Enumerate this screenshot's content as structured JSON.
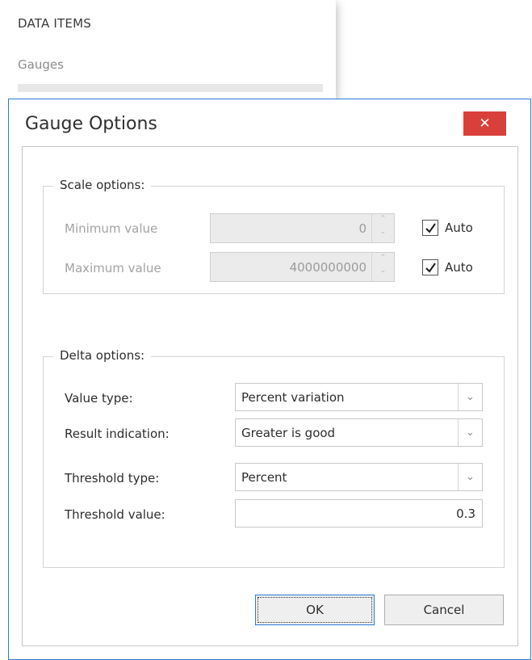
{
  "background_panel": {
    "title": "DATA ITEMS",
    "subtitle": "Gauges"
  },
  "dialog": {
    "title": "Gauge Options",
    "close_glyph": "✕"
  },
  "scale_options": {
    "caption": "Scale options:",
    "minimum": {
      "label": "Minimum value",
      "value": "0",
      "auto_label": "Auto",
      "auto_checked": true
    },
    "maximum": {
      "label": "Maximum value",
      "value": "4000000000",
      "auto_label": "Auto",
      "auto_checked": true
    }
  },
  "delta_options": {
    "caption": "Delta options:",
    "value_type": {
      "label": "Value type:",
      "value": "Percent variation"
    },
    "result_indication": {
      "label": "Result indication:",
      "value": "Greater is good"
    },
    "threshold_type": {
      "label": "Threshold type:",
      "value": "Percent"
    },
    "threshold_value": {
      "label": "Threshold value:",
      "value": "0.3"
    }
  },
  "buttons": {
    "ok": "OK",
    "cancel": "Cancel"
  },
  "icons": {
    "spin_up": "⌃",
    "spin_down": "⌄",
    "dropdown": "⌄"
  },
  "colors": {
    "accent": "#2b79d6",
    "close_button": "#d9403b"
  }
}
